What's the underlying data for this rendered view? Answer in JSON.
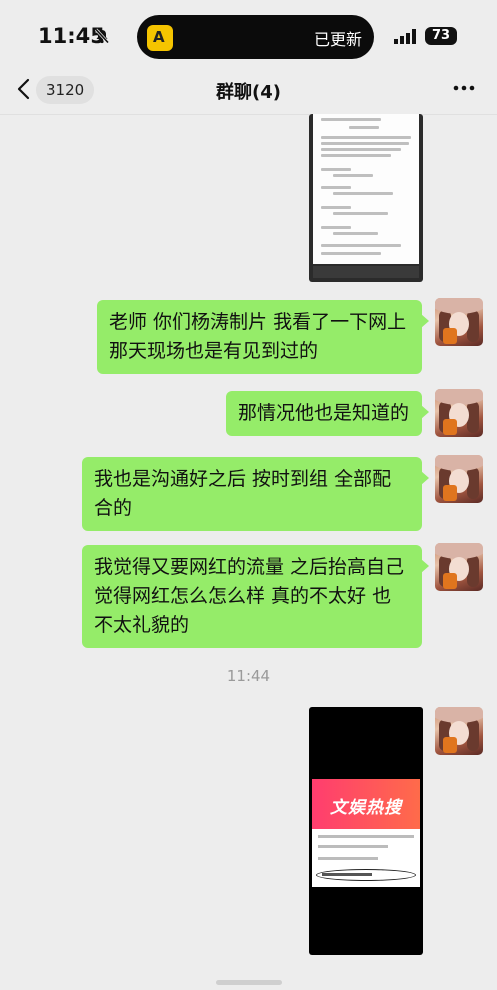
{
  "status_bar": {
    "time": "11:45",
    "notification_text": "已更新",
    "island_app_icon": "A",
    "battery": "73"
  },
  "nav": {
    "unread_count": "3120",
    "title": "群聊(4)"
  },
  "messages": [
    {
      "type": "image",
      "description": "screenshot-comments"
    },
    {
      "type": "text",
      "text": "老师 你们杨涛制片 我看了一下网上那天现场也是有见到过的"
    },
    {
      "type": "text",
      "text": "那情况他也是知道的"
    },
    {
      "type": "text",
      "text": "我也是沟通好之后 按时到组 全部配合的"
    },
    {
      "type": "text",
      "text": "我觉得又要网红的流量 之后抬高自己 觉得网红怎么怎么样 真的不太好 也不太礼貌的"
    },
    {
      "type": "timestamp",
      "text": "11:44"
    },
    {
      "type": "image",
      "description": "screenshot-hot-search",
      "banner_text": "文娱热搜"
    }
  ],
  "colors": {
    "bubble": "#95ec69",
    "background": "#ededed"
  }
}
